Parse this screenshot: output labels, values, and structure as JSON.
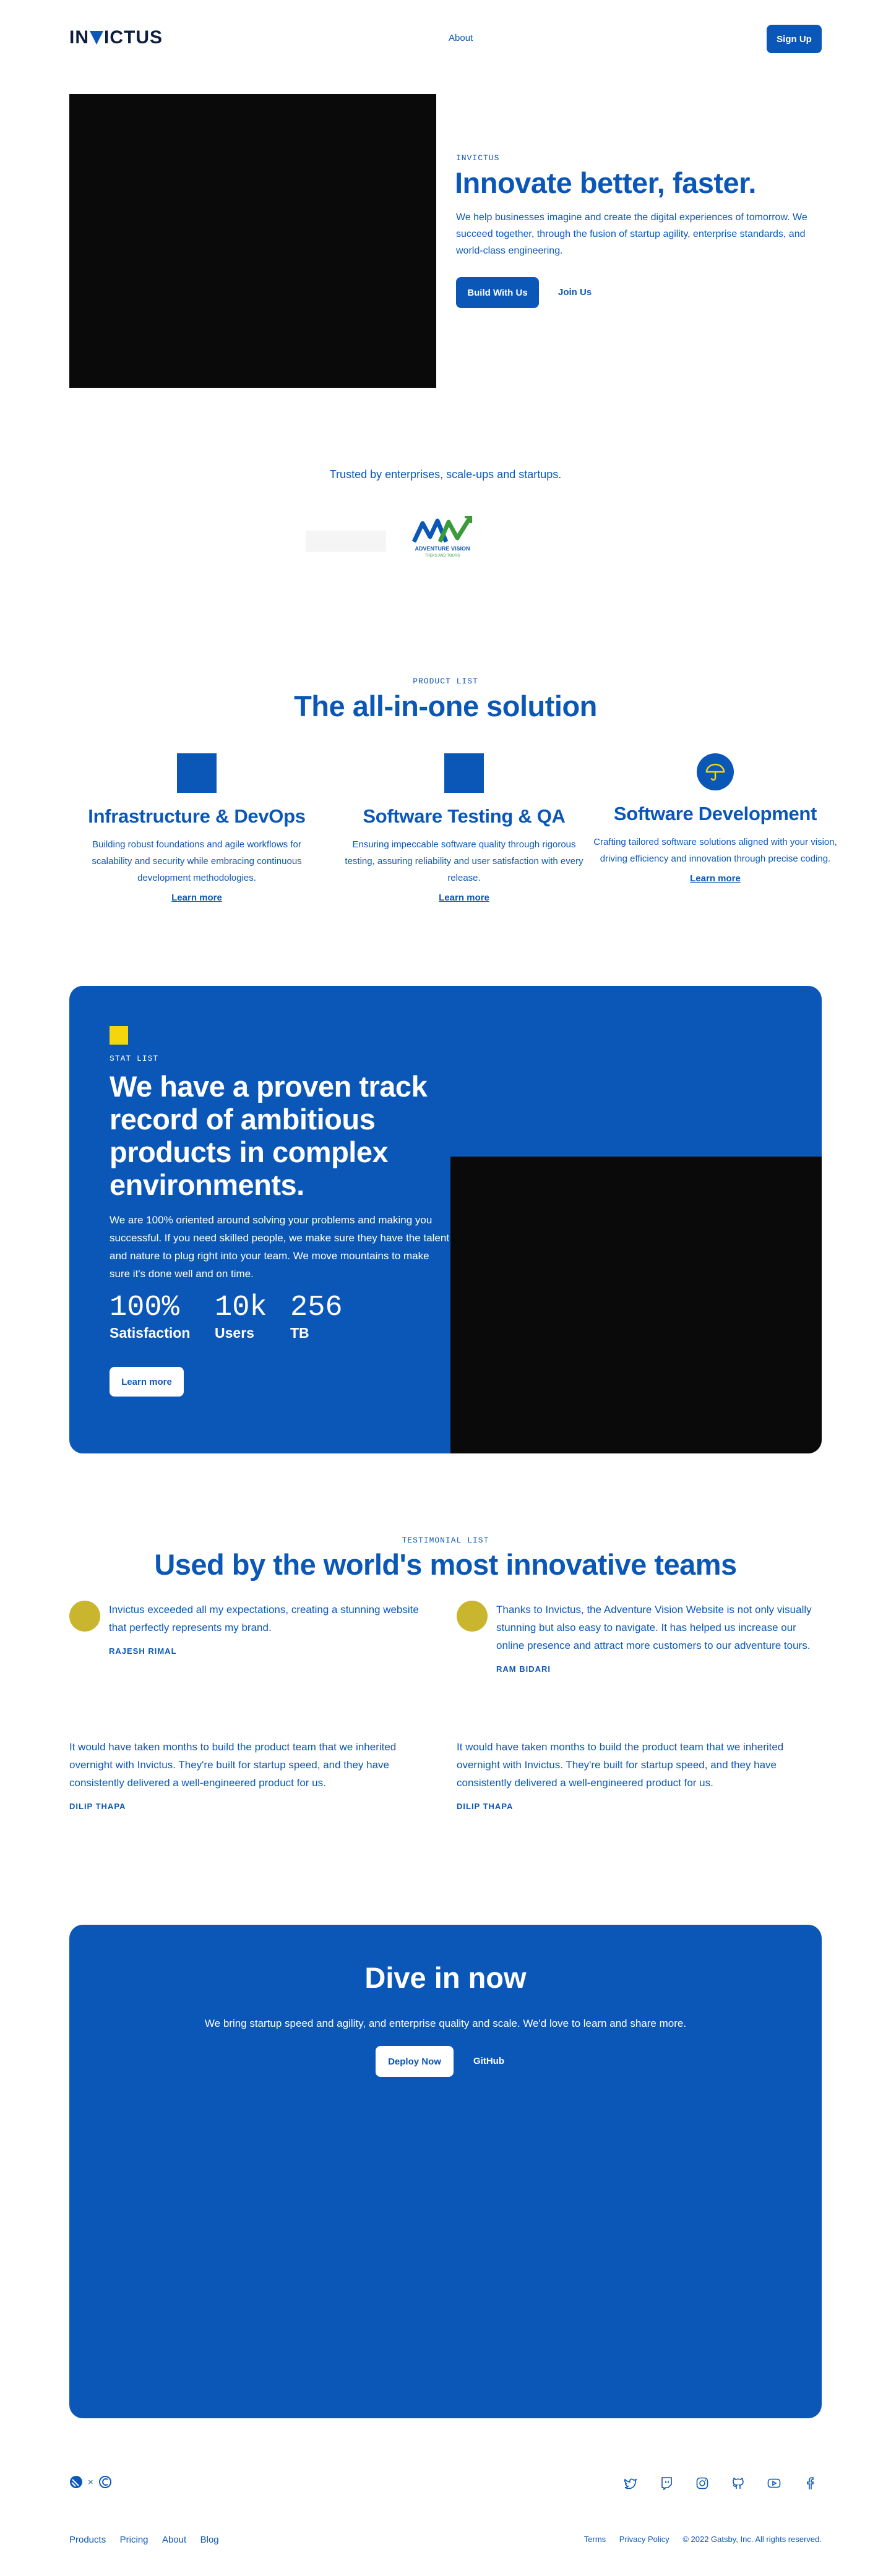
{
  "header": {
    "logo_left": "IN",
    "logo_right": "ICTUS",
    "nav_about": "About",
    "signup": "Sign Up"
  },
  "hero": {
    "kicker": "INVICTUS",
    "title": "Innovate better, faster.",
    "text": "We help businesses imagine and create the digital experiences of tomorrow. We succeed together, through the fusion of startup agility, enterprise standards, and world-class engineering.",
    "primary_button": "Build With Us",
    "secondary_link": "Join Us"
  },
  "trusted": {
    "text": "Trusted by enterprises, scale-ups and startups.",
    "logo_text_1": "ADVENTURE VISION",
    "logo_text_2": "TREKS AND TOURS"
  },
  "products": {
    "kicker": "PRODUCT LIST",
    "title": "The all-in-one solution",
    "items": [
      {
        "title": "Infrastructure & DevOps",
        "text": "Building robust foundations and agile workflows for scalability and security while embracing continuous development methodologies.",
        "link": "Learn more",
        "icon": "square-icon"
      },
      {
        "title": "Software Testing & QA",
        "text": "Ensuring impeccable software quality through rigorous testing, assuring reliability and user satisfaction with every release.",
        "link": "Learn more",
        "icon": "square-icon"
      },
      {
        "title": "Software Development",
        "text": "Crafting tailored software solutions aligned with your vision, driving efficiency and innovation through precise coding.",
        "link": "Learn more",
        "icon": "umbrella-icon"
      }
    ]
  },
  "stats": {
    "kicker": "STAT LIST",
    "title": "We have a proven track record of ambitious products in complex environments.",
    "text": "We are 100% oriented around solving your problems and making you successful. If you need skilled people, we make sure they have the talent and nature to plug right into your team. We move mountains to make sure it's done well and on time.",
    "items": [
      {
        "value": "100%",
        "label": "Satisfaction"
      },
      {
        "value": "10k",
        "label": "Users"
      },
      {
        "value": "256",
        "label": "TB"
      }
    ],
    "button": "Learn more",
    "accent": "#f5d60c"
  },
  "testimonials": {
    "kicker": "TESTIMONIAL LIST",
    "title": "Used by the world's most innovative teams",
    "items": [
      {
        "quote": "Invictus exceeded all my expectations, creating a stunning website that perfectly represents my brand.",
        "author": "RAJESH RIMAL"
      },
      {
        "quote": "Thanks to Invictus, the Adventure Vision Website is not only visually stunning but also easy to navigate. It has helped us increase our online presence and attract more customers to our adventure tours.",
        "author": "RAM BIDARI"
      },
      {
        "quote": "It would have taken months to build the product team that we inherited overnight with Invictus. They're built for startup speed, and they have consistently delivered a well-engineered product for us.",
        "author": "DILIP THAPA"
      },
      {
        "quote": "It would have taken months to build the product team that we inherited overnight with Invictus. They're built for startup speed, and they have consistently delivered a well-engineered product for us.",
        "author": "DILIP THAPA"
      }
    ]
  },
  "cta": {
    "title": "Dive in now",
    "text": "We bring startup speed and agility, and enterprise quality and scale. We'd love to learn and share more.",
    "primary": "Deploy Now",
    "secondary": "GitHub"
  },
  "footer": {
    "times": "×",
    "links": [
      "Products",
      "Pricing",
      "About",
      "Blog"
    ],
    "legal": [
      "Terms",
      "Privacy Policy",
      "© 2022 Gatsby, Inc. All rights reserved."
    ],
    "social_icons": [
      "twitter-icon",
      "twitch-icon",
      "instagram-icon",
      "github-icon",
      "youtube-icon",
      "facebook-icon"
    ]
  },
  "colors": {
    "brand": "#0b57b7",
    "dark": "#0a0a0a",
    "navy": "#0c1d3d"
  }
}
